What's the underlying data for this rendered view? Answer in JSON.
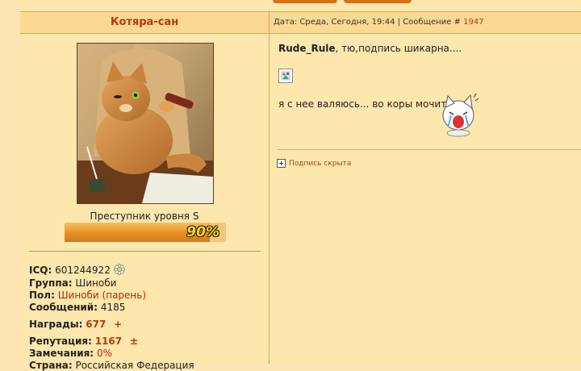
{
  "author": {
    "name": "Котяра-сан"
  },
  "post": {
    "meta_prefix": "Дата: Среда, Сегодня, 19:44 | Сообщение # ",
    "number": "1947",
    "quote_author": "Rude_Rule",
    "quote_text": ", тю,подпись шикарна....",
    "body_text": "я с нее валяюсь... во коры мочит..."
  },
  "profile": {
    "rank_title": "Преступник уровня S",
    "level_percent": 90,
    "level_label": "90%",
    "icq_label": "ICQ:",
    "icq_value": "601244922",
    "group_label": "Группа:",
    "group_value": "Шиноби",
    "gender_label": "Пол:",
    "gender_value": "Шиноби (парень)",
    "messages_label": "Сообщений:",
    "messages_value": "4185",
    "awards_label": "Награды:",
    "awards_value": "677",
    "awards_plus": "+",
    "rep_label": "Репутация:",
    "rep_value": "1167",
    "rep_pm": "±",
    "warn_label": "Замечания:",
    "warn_value": "0%",
    "country_label": "Страна:",
    "country_value": "Российская Федерация"
  },
  "signature": {
    "toggle_label": "Подпись скрыта"
  },
  "icons": {
    "icq_status": "icq-flower-icon",
    "broken_image": "broken-image-icon",
    "expand": "plus-box-icon"
  },
  "colors": {
    "accent": "#b33b0e",
    "bg": "#fde7ad",
    "border": "#e2a04a"
  }
}
